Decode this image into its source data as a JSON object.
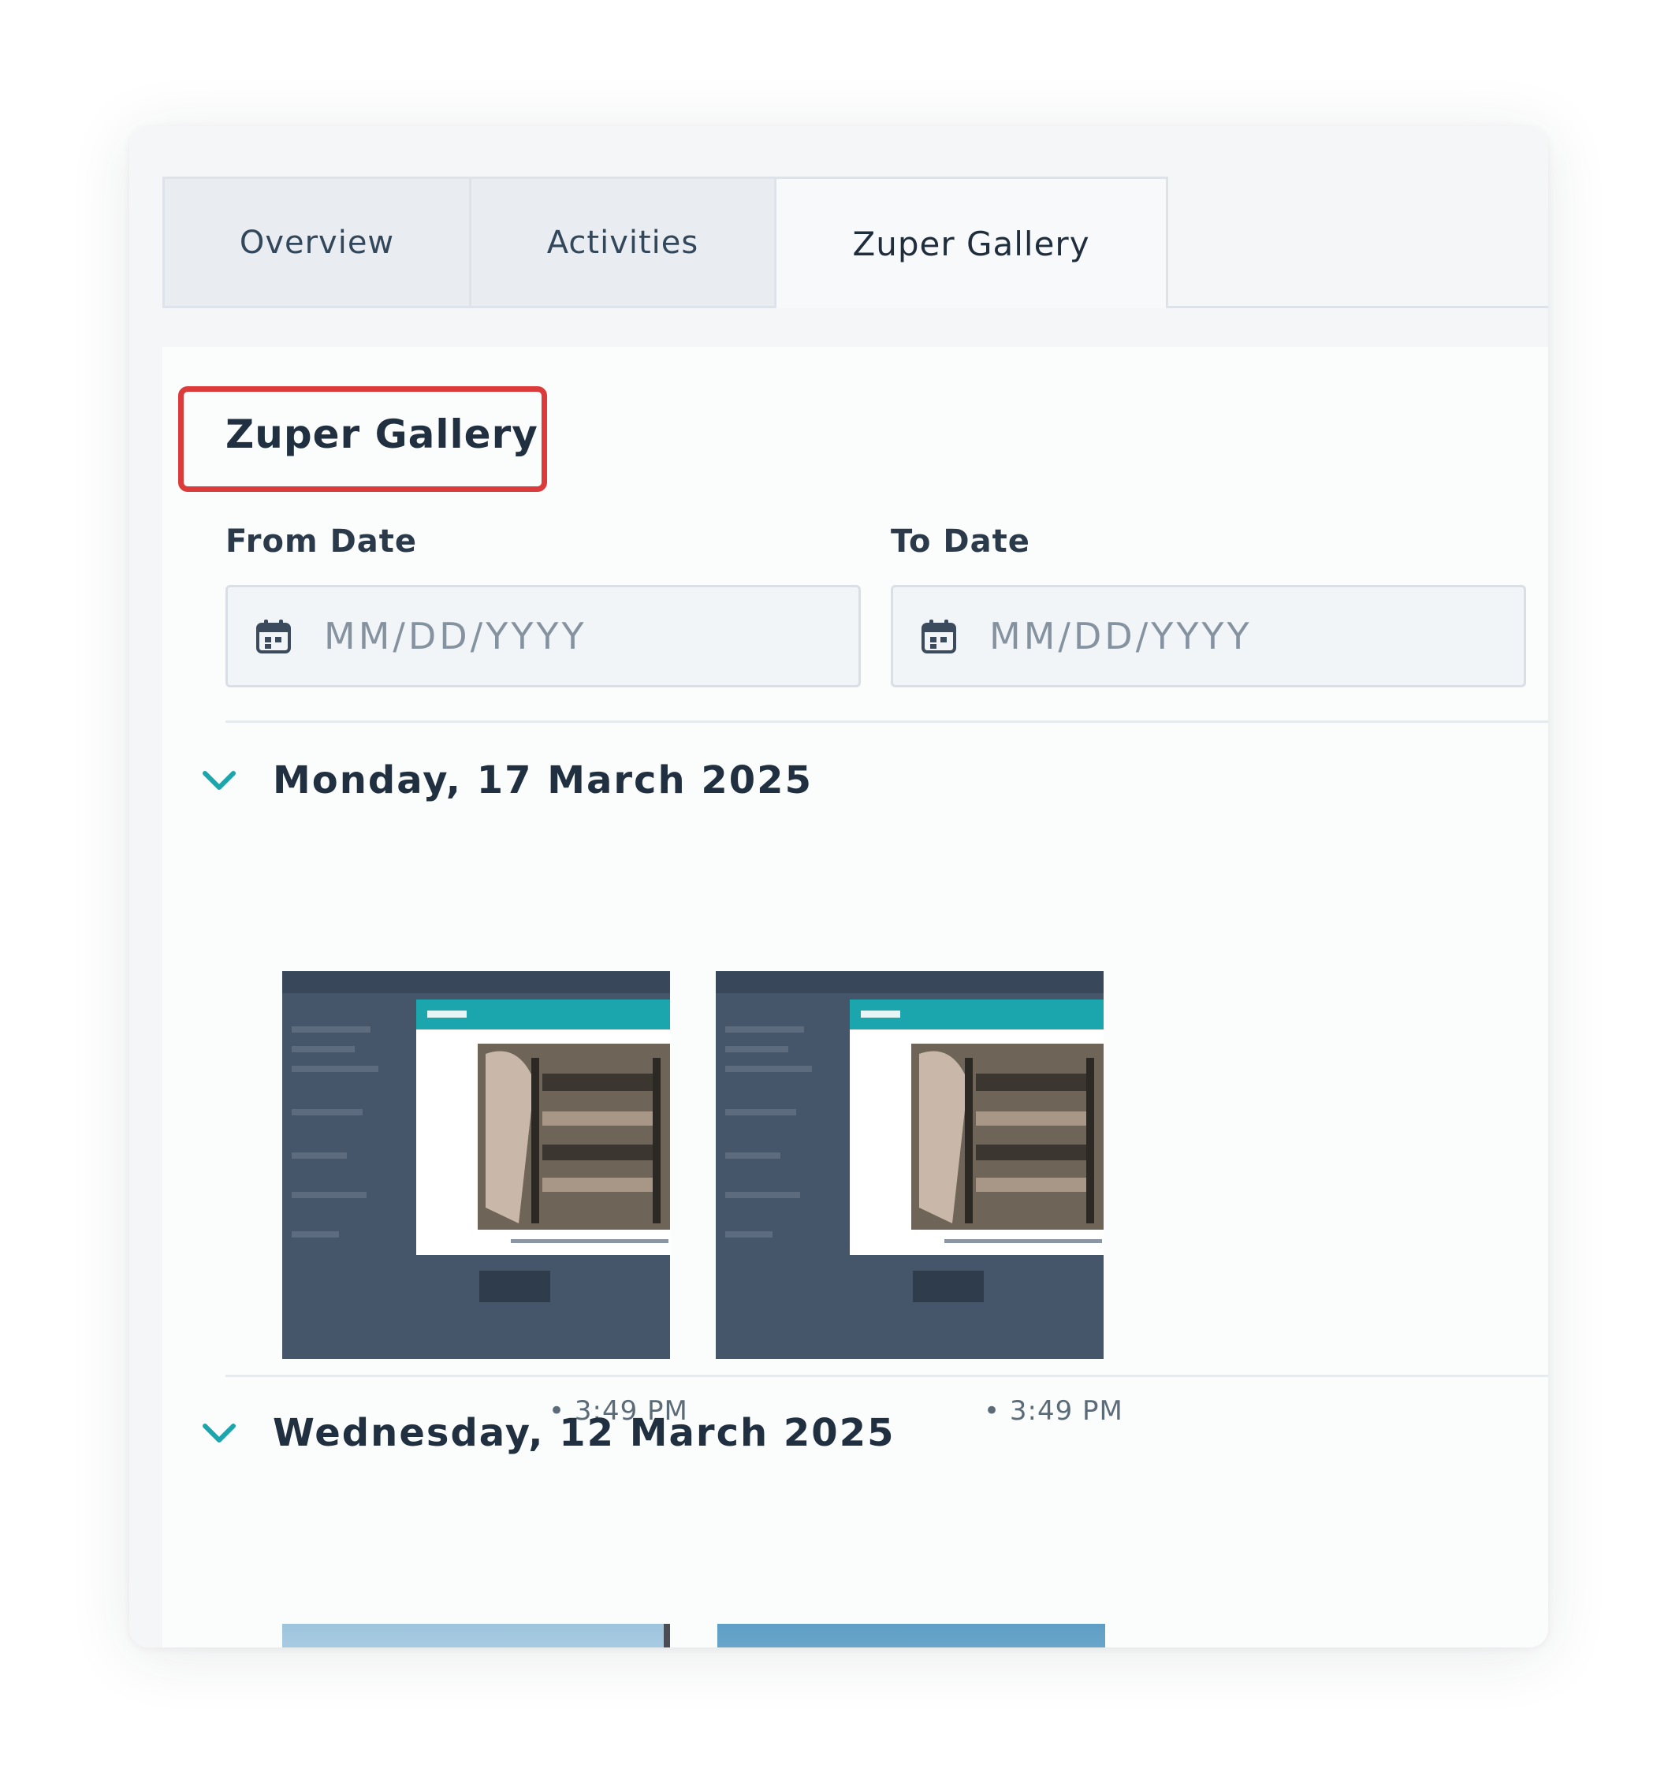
{
  "tabs": [
    {
      "label": "Overview",
      "active": false
    },
    {
      "label": "Activities",
      "active": false
    },
    {
      "label": "Zuper Gallery",
      "active": true
    }
  ],
  "gallery": {
    "title": "Zuper Gallery",
    "from_date": {
      "label": "From Date",
      "placeholder": "MM/DD/YYYY",
      "value": ""
    },
    "to_date": {
      "label": "To Date",
      "placeholder": "MM/DD/YYYY",
      "value": ""
    },
    "groups": [
      {
        "date": "Monday, 17 March 2025",
        "items": [
          {
            "time": "• 3:49 PM",
            "kind": "screenshot"
          },
          {
            "time": "• 3:49 PM",
            "kind": "screenshot"
          }
        ]
      },
      {
        "date": "Wednesday, 12 March 2025",
        "items": [
          {
            "kind": "photo-sky"
          },
          {
            "kind": "photo-sky-building"
          }
        ]
      }
    ]
  },
  "colors": {
    "accent": "#1ba6ad",
    "highlight_border": "#dc3b3b",
    "text_dark": "#203040"
  },
  "icons": {
    "date_input": "calendar-icon",
    "group_toggle": "chevron-down-icon"
  }
}
